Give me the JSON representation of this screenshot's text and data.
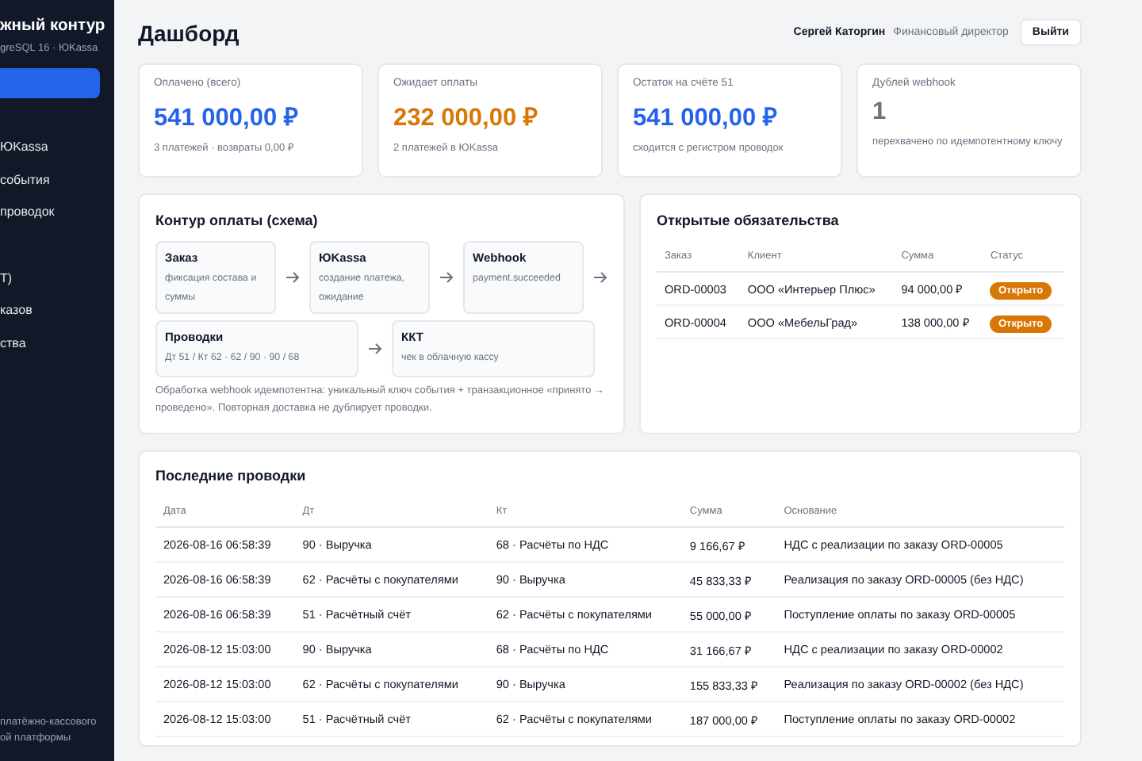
{
  "sidebar": {
    "brand": "жный контур",
    "subtitle": "greSQL 16 · ЮKassa",
    "items": [
      {
        "label": "ЮKassa"
      },
      {
        "label": "события"
      },
      {
        "label": "проводок"
      },
      {
        "label": "Т)"
      },
      {
        "label": "казов"
      },
      {
        "label": "ства"
      }
    ],
    "footer": "платёжно-кассового",
    "footer_2": "ой платформы"
  },
  "header": {
    "title": "Дашборд",
    "user": "Сергей Каторгин",
    "role": "Финансовый директор",
    "logout": "Выйти"
  },
  "stats": [
    {
      "label": "Оплачено (всего)",
      "value": "541 000,00 ₽",
      "color": "#2563eb",
      "note": "3 платежей · возвраты 0,00 ₽"
    },
    {
      "label": "Ожидает оплаты",
      "value": "232 000,00 ₽",
      "color": "#d97706",
      "note": "2 платежей в ЮKassa"
    },
    {
      "label": "Остаток на счёте 51",
      "value": "541 000,00 ₽",
      "color": "#2563eb",
      "note": "сходится с регистром проводок"
    },
    {
      "label": "Дублей webhook",
      "value": "1",
      "color": "#6b7280",
      "note": "перехвачено по идемпотентному ключу"
    }
  ],
  "schema": {
    "title": "Контур оплаты (схема)",
    "row_1": [
      {
        "title": "Заказ",
        "text": "фиксация состава и суммы"
      },
      {
        "title": "ЮKassa",
        "text": "создание платежа, ожидание"
      },
      {
        "title": "Webhook",
        "text": "payment.succeeded"
      }
    ],
    "row_2": [
      {
        "title": "Проводки",
        "text": "Дт 51 / Кт 62 · 62 / 90 · 90 / 68"
      },
      {
        "title": "ККТ",
        "text": "чек в облачную кассу"
      }
    ],
    "note": "Обработка webhook идемпотентна: уникальный ключ события + транзакционное «принято → проведено». Повторная доставка не дублирует проводки."
  },
  "obligations": {
    "title": "Открытые обязательства",
    "columns": [
      "Заказ",
      "Клиент",
      "Сумма",
      "Статус"
    ],
    "rows": [
      {
        "order": "ORD-00003",
        "client": "ООО «Интерьер Плюс»",
        "sum": "94 000,00 ₽",
        "status": "Открыто"
      },
      {
        "order": "ORD-00004",
        "client": "ООО «МебельГрад»",
        "sum": "138 000,00 ₽",
        "status": "Открыто"
      }
    ]
  },
  "entries": {
    "title": "Последние проводки",
    "columns": [
      "Дата",
      "Дт",
      "Кт",
      "Сумма",
      "Основание"
    ],
    "rows": [
      [
        "2026-08-16 06:58:39",
        "90 · Выручка",
        "68 · Расчёты по НДС",
        "9 166,67 ₽",
        "НДС с реализации по заказу ORD-00005"
      ],
      [
        "2026-08-16 06:58:39",
        "62 · Расчёты с покупателями",
        "90 · Выручка",
        "45 833,33 ₽",
        "Реализация по заказу ORD-00005 (без НДС)"
      ],
      [
        "2026-08-16 06:58:39",
        "51 · Расчётный счёт",
        "62 · Расчёты с покупателями",
        "55 000,00 ₽",
        "Поступление оплаты по заказу ORD-00005"
      ],
      [
        "2026-08-12 15:03:00",
        "90 · Выручка",
        "68 · Расчёты по НДС",
        "31 166,67 ₽",
        "НДС с реализации по заказу ORD-00002"
      ],
      [
        "2026-08-12 15:03:00",
        "62 · Расчёты с покупателями",
        "90 · Выручка",
        "155 833,33 ₽",
        "Реализация по заказу ORD-00002 (без НДС)"
      ],
      [
        "2026-08-12 15:03:00",
        "51 · Расчётный счёт",
        "62 · Расчёты с покупателями",
        "187 000,00 ₽",
        "Поступление оплаты по заказу ORD-00002"
      ]
    ]
  }
}
